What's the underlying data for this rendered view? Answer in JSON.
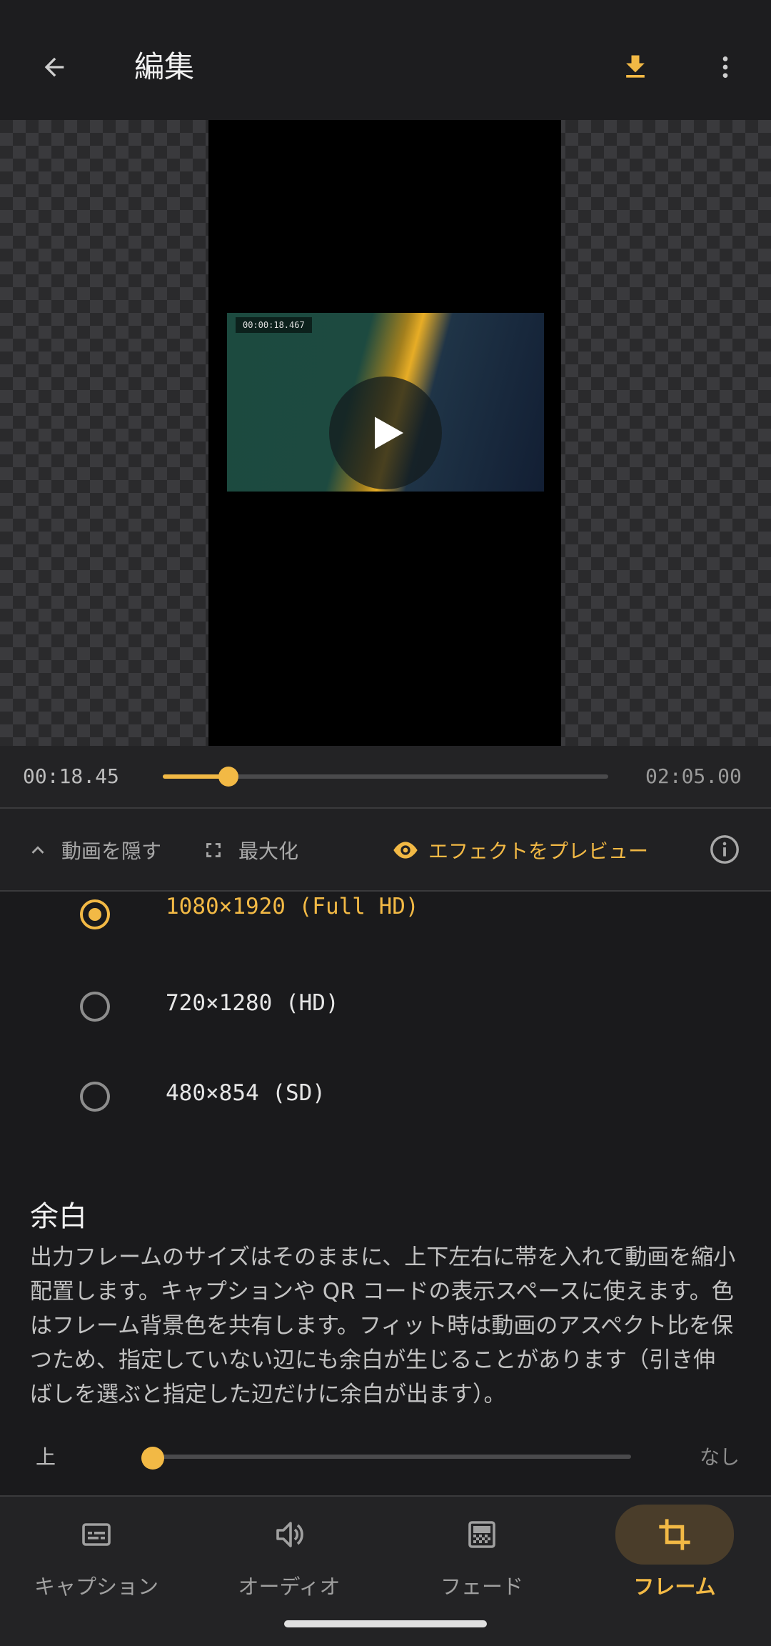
{
  "header": {
    "title": "編集",
    "back_icon": "arrow-left-icon",
    "download_icon": "download-icon",
    "menu_icon": "more-vert-icon",
    "accent_color": "#f2b945"
  },
  "preview": {
    "overlay_timestamp": "00:00:18.467",
    "play_icon": "play-icon"
  },
  "playback": {
    "current_time": "00:18.45",
    "total_time": "02:05.00",
    "progress_fraction": 0.1476
  },
  "controls": {
    "hide_video": "動画を隠す",
    "maximize": "最大化",
    "preview_effects": "エフェクトをプレビュー",
    "info_icon": "info-icon"
  },
  "resolution": {
    "options": [
      {
        "label": "1080×1920 (Full HD)",
        "selected": true
      },
      {
        "label": "720×1280 (HD)",
        "selected": false
      },
      {
        "label": "480×854 (SD)",
        "selected": false
      }
    ]
  },
  "margin": {
    "title": "余白",
    "description": "出力フレームのサイズはそのままに、上下左右に帯を入れて動画を縮小配置します。キャプションや QR コードの表示スペースに使えます。色はフレーム背景色を共有します。フィット時は動画のアスペクト比を保つため、指定していない辺にも余白が生じることがあります（引き伸ばしを選ぶと指定した辺だけに余白が出ます）。",
    "slider_label": "上",
    "slider_value": "なし",
    "slider_fraction": 0
  },
  "bottom_nav": {
    "items": [
      {
        "label": "キャプション",
        "icon": "subtitles-icon",
        "active": false
      },
      {
        "label": "オーディオ",
        "icon": "volume-icon",
        "active": false
      },
      {
        "label": "フェード",
        "icon": "gradient-icon",
        "active": false
      },
      {
        "label": "フレーム",
        "icon": "crop-icon",
        "active": true
      }
    ]
  }
}
